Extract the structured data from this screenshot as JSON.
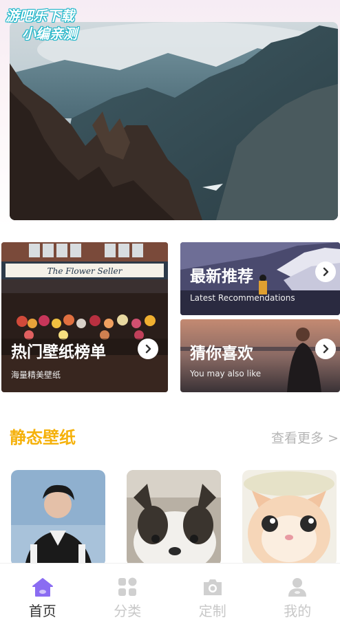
{
  "watermark": {
    "line1": "游吧乐下载",
    "line2": "小编亲测"
  },
  "hero": {
    "alt": "mountain landscape banner"
  },
  "tiles": {
    "hot": {
      "title": "热门壁纸榜单",
      "subtitle": "海量精美壁纸"
    },
    "latest": {
      "title": "最新推荐",
      "subtitle": "Latest Recommendations"
    },
    "guess": {
      "title": "猜你喜欢",
      "subtitle": "You may also like"
    },
    "shop_sign": "The Flower Seller"
  },
  "section": {
    "title": "静态壁纸",
    "more": "查看更多 >"
  },
  "tabs": [
    {
      "label": "首页",
      "icon": "home-icon"
    },
    {
      "label": "分类",
      "icon": "grid-icon"
    },
    {
      "label": "定制",
      "icon": "camera-icon"
    },
    {
      "label": "我的",
      "icon": "user-icon"
    }
  ],
  "colors": {
    "accent": "#f5b10a",
    "tab_active_icon": "#8a6cf2",
    "tab_inactive": "#c8c8c8"
  }
}
